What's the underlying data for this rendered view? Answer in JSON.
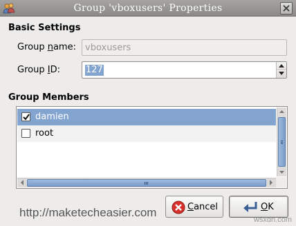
{
  "window": {
    "title": "Group 'vboxusers' Properties",
    "close_icon": "close-icon"
  },
  "basic_settings": {
    "heading": "Basic Settings",
    "group_name_label_pre": "Group ",
    "group_name_label_ul": "n",
    "group_name_label_post": "ame:",
    "group_name_value": "vboxusers",
    "group_id_label_pre": "Group ",
    "group_id_label_ul": "I",
    "group_id_label_post": "D:",
    "group_id_value": "127"
  },
  "group_members": {
    "heading": "Group Members",
    "items": [
      {
        "label": "damien",
        "checked": true,
        "selected": true
      },
      {
        "label": "root",
        "checked": false,
        "selected": false
      }
    ]
  },
  "footer": {
    "watermark": "http://maketecheasier.com",
    "cancel_label_ul": "C",
    "cancel_label_post": "ancel",
    "ok_label_ul": "O",
    "ok_label_post": "K",
    "brand": "wsxdn.com"
  },
  "colors": {
    "selection": "#82a4cf",
    "titlebar": "#9a9997"
  }
}
